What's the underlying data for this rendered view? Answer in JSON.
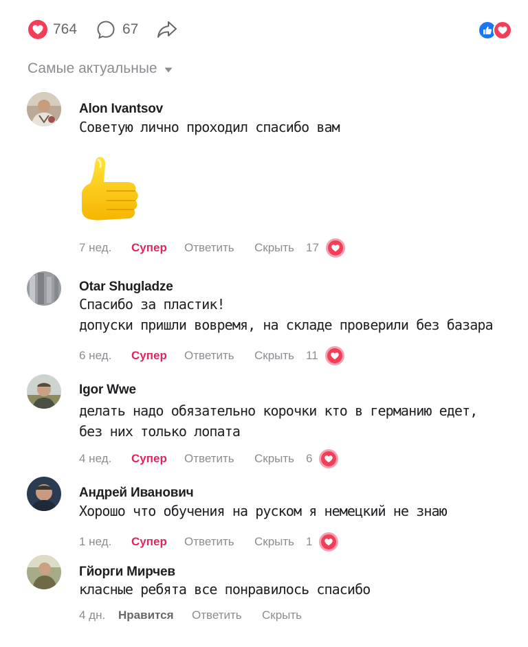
{
  "stats": {
    "likes": "764",
    "comments": "67"
  },
  "reaction_icons": [
    "like-icon",
    "love-icon"
  ],
  "sort": {
    "label": "Самые актуальные"
  },
  "comments": [
    {
      "author": "Alon Ivantsov",
      "lines": [
        "Советую лично проходил спасибо вам"
      ],
      "sticker": "thumbs-up-sticker",
      "time": "7 нед.",
      "react_label": "Супер",
      "reply_label": "Ответить",
      "hide_label": "Скрыть",
      "reaction_count": "17"
    },
    {
      "author": "Otar Shugladze",
      "lines": [
        "Спасибо за пластик!",
        "допуски пришли вовремя, на складе проверили без базара"
      ],
      "time": "6 нед.",
      "react_label": "Супер",
      "reply_label": "Ответить",
      "hide_label": "Скрыть",
      "reaction_count": "11"
    },
    {
      "author": "Igor Wwe",
      "lines": [
        "делать надо обязательно корочки кто в германию едет,",
        "без них только лопата"
      ],
      "time": "4 нед.",
      "react_label": "Супер",
      "reply_label": "Ответить",
      "hide_label": "Скрыть",
      "reaction_count": "6"
    },
    {
      "author": "Андрей Иванович",
      "lines": [
        "Хорошо что обучения на руском я немецкий не знаю"
      ],
      "time": "1 нед.",
      "react_label": "Супер",
      "reply_label": "Ответить",
      "hide_label": "Скрыть",
      "reaction_count": "1"
    },
    {
      "author": "Гйорги Мирчев",
      "lines": [
        "класные ребята все понравилось спасибо"
      ],
      "time": "4 дн.",
      "react_label": "Нравится",
      "reply_label": "Ответить",
      "hide_label": "Скрыть",
      "reaction_count": ""
    }
  ],
  "colors": {
    "accent_red": "#e0245e",
    "love": "#f33e58",
    "like": "#1877f2",
    "muted": "#8a8d91"
  }
}
